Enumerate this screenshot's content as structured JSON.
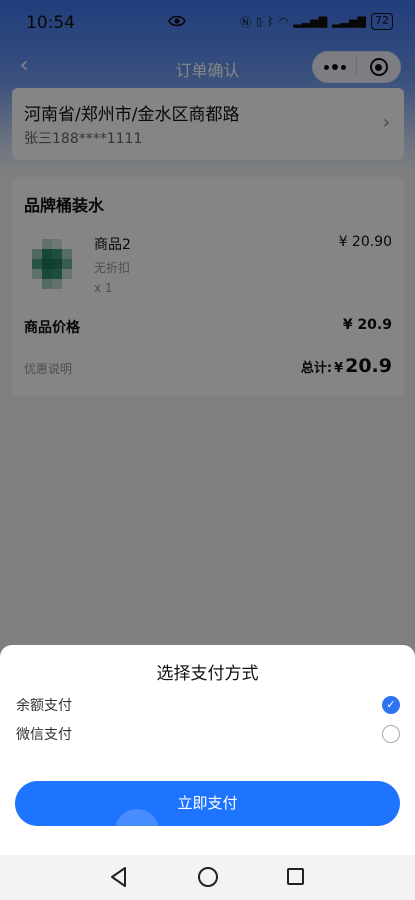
{
  "status_bar": {
    "time": "10:54",
    "icons": [
      "eye-icon",
      "nfc-icon",
      "vibrate-icon",
      "bluetooth-icon",
      "wifi-icon",
      "signal-4g-icon",
      "signal-4g-icon"
    ],
    "battery": "72"
  },
  "nav": {
    "title": "订单确认",
    "back_icon": "chevron-left-icon",
    "capsule": [
      "more-icon",
      "close-target-icon"
    ]
  },
  "address": {
    "line": "河南省/郑州市/金水区商都路",
    "contact": "张三188****1111",
    "arrow_icon": "chevron-right-icon"
  },
  "order": {
    "shop_name": "品牌桶装水",
    "item": {
      "name": "商品2",
      "discount": "无折扣",
      "quantity": "x 1",
      "price": "¥ 20.90"
    },
    "goods_price_label": "商品价格",
    "goods_price_value": "¥ 20.9",
    "promo_label": "优惠说明",
    "total_label": "总计:",
    "total_currency": "¥",
    "total_value": "20.9"
  },
  "payment_sheet": {
    "title": "选择支付方式",
    "options": [
      {
        "label": "余额支付",
        "selected": true
      },
      {
        "label": "微信支付",
        "selected": false
      }
    ],
    "check_glyph": "✓",
    "pay_button": "立即支付"
  },
  "colors": {
    "accent": "#1f74ff",
    "header_top": "#3f76ee"
  }
}
